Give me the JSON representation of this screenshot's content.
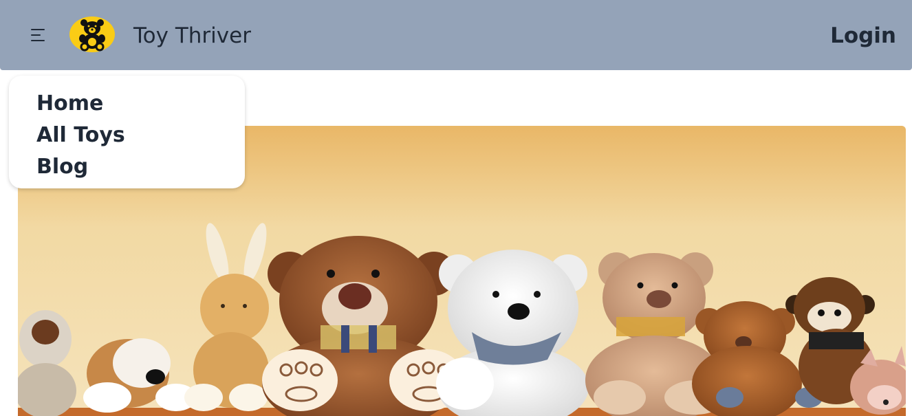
{
  "navbar": {
    "brand": "Toy Thriver",
    "logo_icon": "teddy-bear-logo",
    "logo_color": "#facc15",
    "menu_icon": "hamburger-menu-icon",
    "login_label": "Login",
    "background": "#94a3b8"
  },
  "menu": {
    "items": [
      {
        "label": "Home"
      },
      {
        "label": "All Toys"
      },
      {
        "label": "Blog"
      }
    ]
  },
  "hero": {
    "image": "stuffed-toys-lined-up-on-shelf"
  }
}
